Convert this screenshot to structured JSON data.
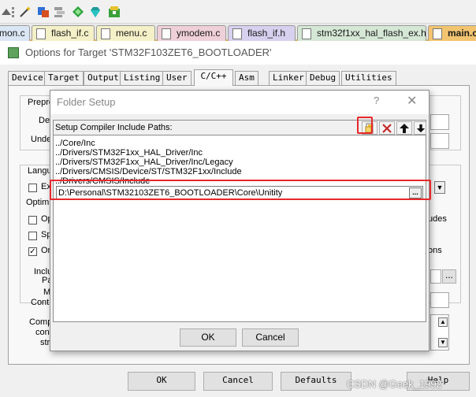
{
  "editor_tabs": [
    {
      "label": "mon.c"
    },
    {
      "label": "flash_if.c"
    },
    {
      "label": "menu.c"
    },
    {
      "label": "ymodem.c"
    },
    {
      "label": "flash_if.h"
    },
    {
      "label": "stm32f1xx_hal_flash_ex.h"
    },
    {
      "label": "main.c"
    }
  ],
  "options_dialog": {
    "title": "Options for Target 'STM32F103ZET6_BOOTLOADER'",
    "tabs": [
      "Device",
      "Target",
      "Output",
      "Listing",
      "User",
      "C/C++",
      "Asm",
      "Linker",
      "Debug",
      "Utilities"
    ],
    "active_tab": "C/C++",
    "partial_labels": {
      "prepro": "Prepro",
      "def": "De",
      "undef": "Unde",
      "langu": "Langu",
      "ex": "Ex",
      "optimi": "Optimi",
      "op": "Op",
      "sp": "Sp",
      "on": "On",
      "includes": "udes",
      "options": "ons",
      "inclu": "Inclu",
      "path": "Pat",
      "misc": "M",
      "contr": "Contr",
      "comp": "Comp",
      "cont": "cont",
      "str": "str"
    },
    "buttons": {
      "ok": "OK",
      "cancel": "Cancel",
      "defaults": "Defaults",
      "help": "Help"
    }
  },
  "folder_dialog": {
    "title": "Folder Setup",
    "help_glyph": "?",
    "close_glyph": "✕",
    "header_label": "Setup Compiler Include Paths:",
    "paths": [
      "../Core/Inc",
      "../Drivers/STM32F1xx_HAL_Driver/Inc",
      "../Drivers/STM32F1xx_HAL_Driver/Inc/Legacy",
      "../Drivers/CMSIS/Device/ST/STM32F1xx/Include",
      "../Drivers/CMSIS/Include"
    ],
    "edit_value": "D:\\Personal\\STM32103ZET6_BOOTLOADER\\Core\\Unitity",
    "browse_label": "...",
    "ok_label": "OK",
    "cancel_label": "Cancel"
  },
  "watermark": "CSDN @Geek_1992",
  "colors": {
    "highlight": "#e8282b",
    "active_tab_underline": "#f3b94c"
  }
}
